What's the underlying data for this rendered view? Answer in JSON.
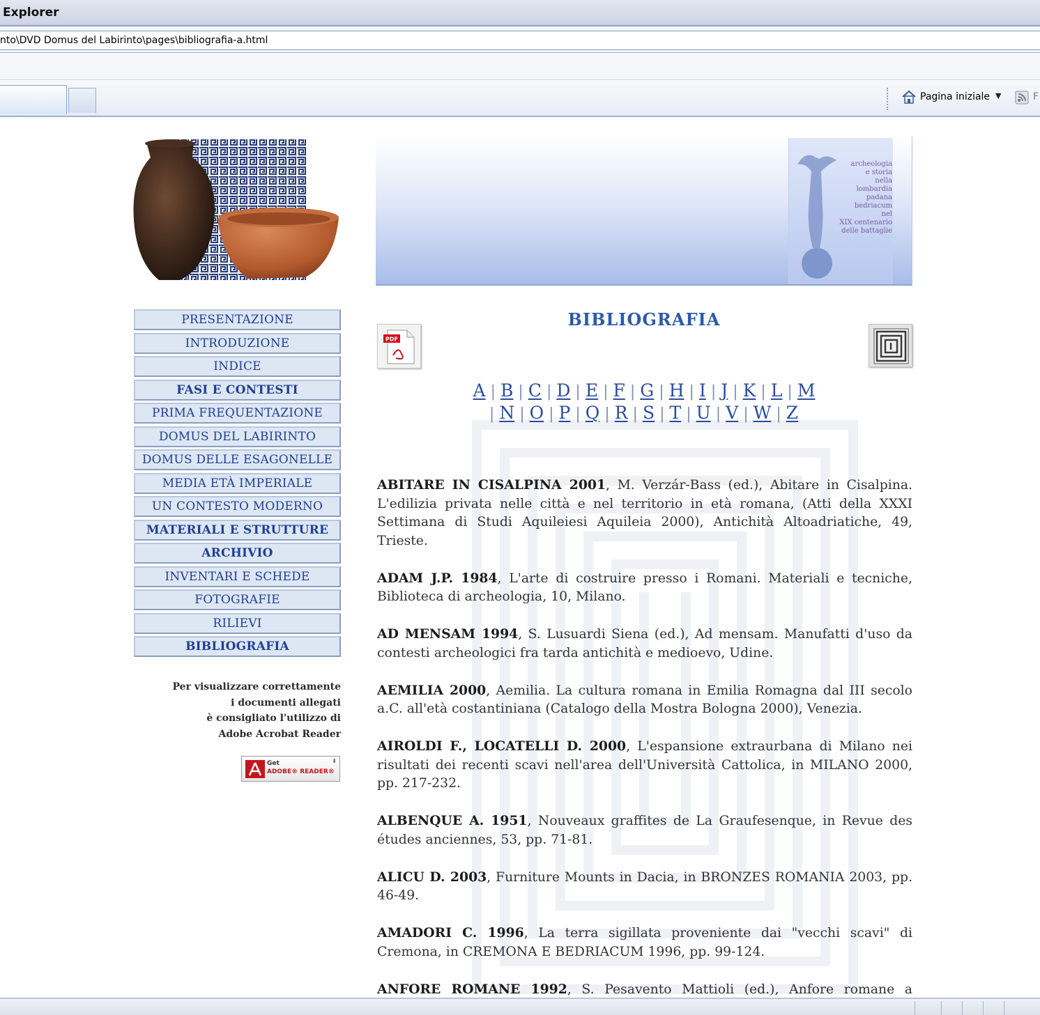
{
  "browser": {
    "title": "Explorer",
    "address": "nto\\DVD Domus del Labirinto\\pages\\bibliografia-a.html",
    "home_label": "Pagina iniziale",
    "feed_cut": "F"
  },
  "banner": {
    "book_lines": "archeologia\ne storia\nnella\nlombardia\npadana",
    "book_lines2": "bedriacum\nnel\nXIX centenario\ndelle battaglie"
  },
  "menu": [
    {
      "label": "PRESENTAZIONE",
      "bold": false
    },
    {
      "label": "INTRODUZIONE",
      "bold": false
    },
    {
      "label": "INDICE",
      "bold": false
    },
    {
      "label": "FASI E CONTESTI",
      "bold": true
    },
    {
      "label": "PRIMA FREQUENTAZIONE",
      "bold": false
    },
    {
      "label": "DOMUS DEL LABIRINTO",
      "bold": false
    },
    {
      "label": "DOMUS DELLE ESAGONELLE",
      "bold": false
    },
    {
      "label": "MEDIA ETÀ IMPERIALE",
      "bold": false
    },
    {
      "label": "UN CONTESTO MODERNO",
      "bold": false
    },
    {
      "label": "MATERIALI E STRUTTURE",
      "bold": true
    },
    {
      "label": "ARCHIVIO",
      "bold": true
    },
    {
      "label": "INVENTARI E SCHEDE",
      "bold": false
    },
    {
      "label": "FOTOGRAFIE",
      "bold": false
    },
    {
      "label": "RILIEVI",
      "bold": false
    },
    {
      "label": "BIBLIOGRAFIA",
      "bold": true
    }
  ],
  "note": {
    "line1": "Per visualizzare correttamente",
    "line2": "i documenti allegati",
    "line3": "è consigliato l'utilizzo di",
    "line4": "Adobe Acrobat Reader"
  },
  "get_reader": {
    "get": "Get",
    "brand": "ADOBE® READER®"
  },
  "page": {
    "title": "BIBLIOGRAFIA"
  },
  "alphabet": {
    "row1": [
      "A",
      "B",
      "C",
      "D",
      "E",
      "F",
      "G",
      "H",
      "I",
      "J",
      "K",
      "L",
      "M"
    ],
    "row2": [
      "N",
      "O",
      "P",
      "Q",
      "R",
      "S",
      "T",
      "U",
      "V",
      "W",
      "Z"
    ]
  },
  "entries": [
    {
      "head": "ABITARE IN CISALPINA 2001",
      "text": ", M. Verzár-Bass (ed.), Abitare in Cisalpina. L'edilizia privata nelle città e nel territorio in età romana, (Atti della XXXI Settimana di Studi Aquileiesi Aquileia 2000), Antichità Altoadriatiche, 49, Trieste."
    },
    {
      "head": "ADAM J.P. 1984",
      "text": ", L'arte di costruire presso i Romani. Materiali e tecniche, Biblioteca di archeologia, 10, Milano."
    },
    {
      "head": "AD MENSAM 1994",
      "text": ", S. Lusuardi Siena (ed.), Ad mensam. Manufatti d'uso da contesti archeologici fra tarda antichità e medioevo, Udine."
    },
    {
      "head": "AEMILIA 2000",
      "text": ", Aemilia. La cultura romana in Emilia Romagna dal III secolo a.C. all'età costantiniana (Catalogo della Mostra Bologna 2000), Venezia."
    },
    {
      "head": "AIROLDI F., LOCATELLI D. 2000",
      "text": ", L'espansione extraurbana di Milano nei risultati dei recenti scavi nell'area dell'Università Cattolica, in MILANO 2000, pp. 217-232."
    },
    {
      "head": "ALBENQUE A. 1951",
      "text": ", Nouveaux graffites de La Graufesenque, in Revue des études anciennes, 53, pp. 71-81."
    },
    {
      "head": "ALICU D. 2003",
      "text": ", Furniture Mounts in Dacia, in BRONZES ROMANIA 2003, pp. 46-49."
    },
    {
      "head": "AMADORI C. 1996",
      "text": ", La terra sigillata proveniente dai \"vecchi scavi\" di Cremona, in CREMONA E BEDRIACUM 1996, pp. 99-124."
    },
    {
      "head": "ANFORE ROMANE 1992",
      "text": ", S. Pesavento Mattioli (ed.), Anfore romane a Padova: ritrovamenti dalla città, Modena."
    }
  ]
}
